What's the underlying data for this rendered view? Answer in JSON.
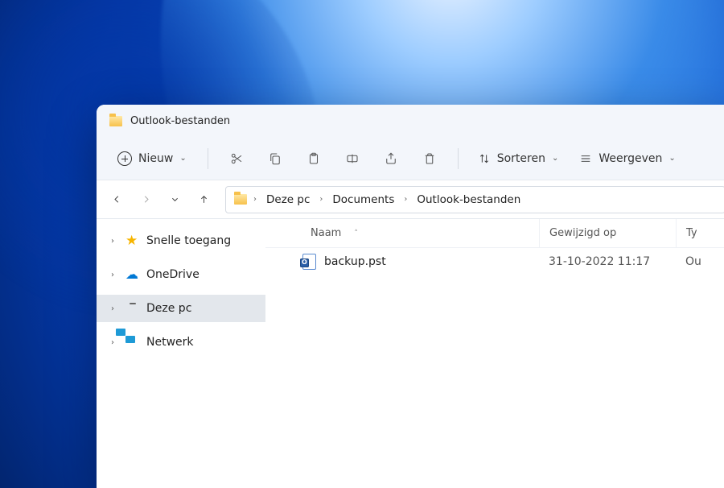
{
  "window_title": "Outlook-bestanden",
  "toolbar": {
    "new_label": "Nieuw",
    "sort_label": "Sorteren",
    "view_label": "Weergeven"
  },
  "breadcrumbs": {
    "root": "Deze pc",
    "p1": "Documents",
    "p2": "Outlook-bestanden"
  },
  "sidebar": {
    "items": [
      {
        "label": "Snelle toegang"
      },
      {
        "label": "OneDrive"
      },
      {
        "label": "Deze pc"
      },
      {
        "label": "Netwerk"
      }
    ]
  },
  "columns": {
    "name": "Naam",
    "modified": "Gewijzigd op",
    "type": "Ty"
  },
  "files": [
    {
      "name": "backup.pst",
      "modified": "31-10-2022 11:17",
      "type": "Ou"
    }
  ]
}
